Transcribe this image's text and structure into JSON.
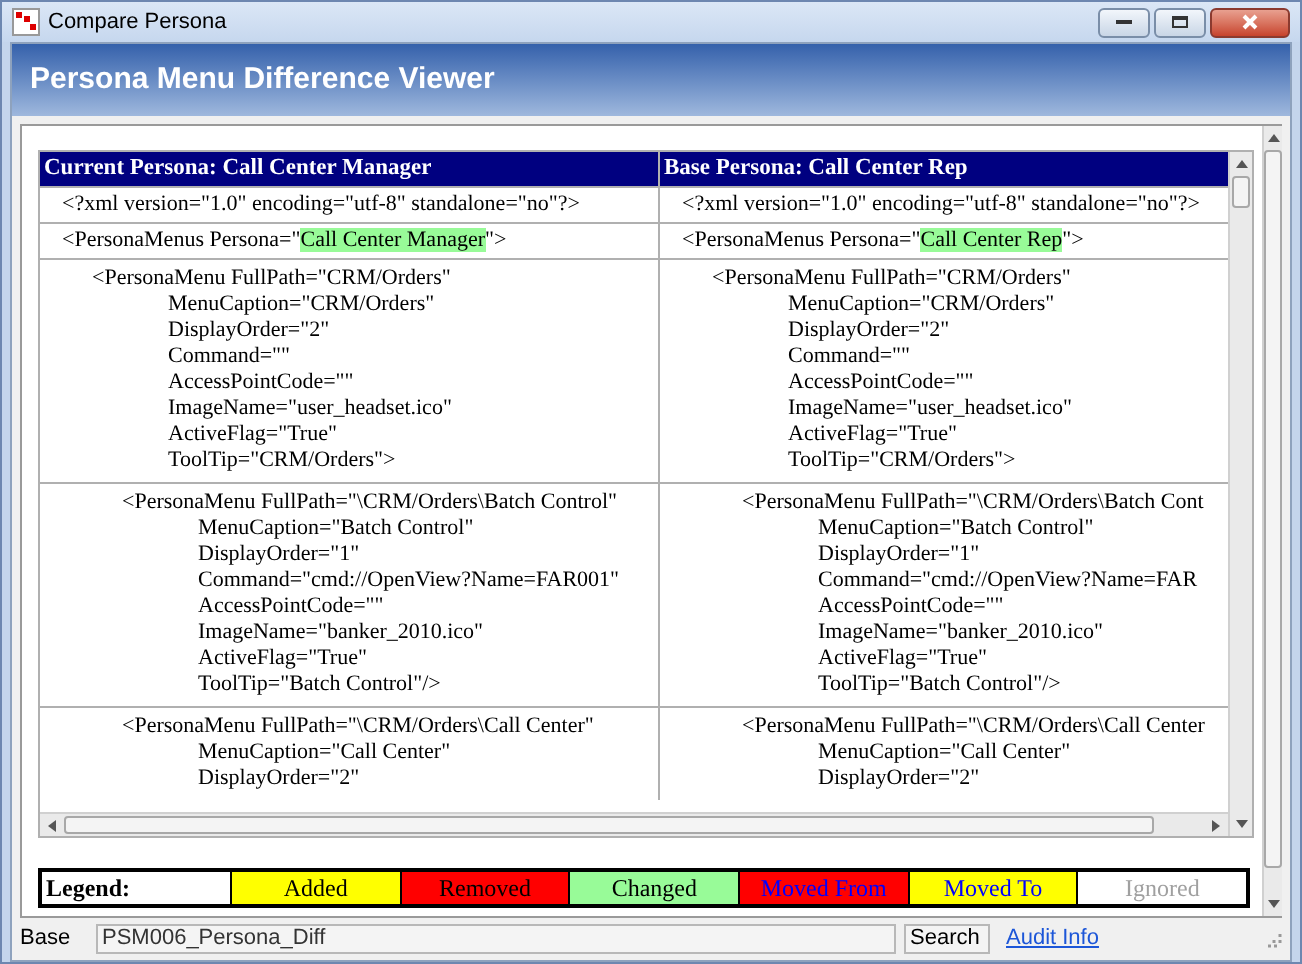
{
  "window": {
    "title": "Compare Persona"
  },
  "header": {
    "title": "Persona Menu Difference Viewer"
  },
  "table": {
    "columns": [
      "Current Persona: Call Center Manager",
      "Base Persona: Call Center Rep"
    ],
    "rows": [
      {
        "kind": "declaration",
        "cells": [
          {
            "tag": [
              {
                "text": "<?xml version=\"1.0\" encoding=\"utf-8\" standalone=\"no\"?>",
                "changed": false
              }
            ]
          },
          {
            "tag": [
              {
                "text": "<?xml version=\"1.0\" encoding=\"utf-8\" standalone=\"no\"?>",
                "changed": false
              }
            ]
          }
        ]
      },
      {
        "kind": "declaration",
        "cells": [
          {
            "tag": [
              {
                "text": "<PersonaMenus Persona=\"",
                "changed": false
              },
              {
                "text": "Call Center Manager",
                "changed": true
              },
              {
                "text": "\">",
                "changed": false
              }
            ]
          },
          {
            "tag": [
              {
                "text": "<PersonaMenus Persona=\"",
                "changed": false
              },
              {
                "text": "Call Center Rep",
                "changed": true
              },
              {
                "text": "\">",
                "changed": false
              }
            ]
          }
        ]
      },
      {
        "kind": "menu",
        "cells": [
          {
            "tag": [
              {
                "text": "<PersonaMenu FullPath=\"CRM/Orders\"",
                "changed": false
              }
            ],
            "attributes": [
              "MenuCaption=\"CRM/Orders\"",
              "DisplayOrder=\"2\"",
              "Command=\"\"",
              "AccessPointCode=\"\"",
              "ImageName=\"user_headset.ico\"",
              "ActiveFlag=\"True\"",
              "ToolTip=\"CRM/Orders\">"
            ]
          },
          {
            "tag": [
              {
                "text": "<PersonaMenu FullPath=\"CRM/Orders\"",
                "changed": false
              }
            ],
            "attributes": [
              "MenuCaption=\"CRM/Orders\"",
              "DisplayOrder=\"2\"",
              "Command=\"\"",
              "AccessPointCode=\"\"",
              "ImageName=\"user_headset.ico\"",
              "ActiveFlag=\"True\"",
              "ToolTip=\"CRM/Orders\">"
            ]
          }
        ]
      },
      {
        "kind": "submenu",
        "cells": [
          {
            "tag": [
              {
                "text": "<PersonaMenu FullPath=\"\\CRM/Orders\\Batch Control\"",
                "changed": false
              }
            ],
            "attributes": [
              "MenuCaption=\"Batch Control\"",
              "DisplayOrder=\"1\"",
              "Command=\"cmd://OpenView?Name=FAR001\"",
              "AccessPointCode=\"\"",
              "ImageName=\"banker_2010.ico\"",
              "ActiveFlag=\"True\"",
              "ToolTip=\"Batch Control\"/>"
            ]
          },
          {
            "tag": [
              {
                "text": "<PersonaMenu FullPath=\"\\CRM/Orders\\Batch Cont",
                "changed": false
              }
            ],
            "attributes": [
              "MenuCaption=\"Batch Control\"",
              "DisplayOrder=\"1\"",
              "Command=\"cmd://OpenView?Name=FAR",
              "AccessPointCode=\"\"",
              "ImageName=\"banker_2010.ico\"",
              "ActiveFlag=\"True\"",
              "ToolTip=\"Batch Control\"/>"
            ]
          }
        ]
      },
      {
        "kind": "submenu",
        "cells": [
          {
            "tag": [
              {
                "text": "<PersonaMenu FullPath=\"\\CRM/Orders\\Call Center\"",
                "changed": false
              }
            ],
            "attributes": [
              "MenuCaption=\"Call Center\"",
              "DisplayOrder=\"2\""
            ]
          },
          {
            "tag": [
              {
                "text": "<PersonaMenu FullPath=\"\\CRM/Orders\\Call Center",
                "changed": false
              }
            ],
            "attributes": [
              "MenuCaption=\"Call Center\"",
              "DisplayOrder=\"2\""
            ]
          }
        ]
      }
    ]
  },
  "legend": {
    "label": "Legend:",
    "items": [
      {
        "label": "Added",
        "color": "#ffff00",
        "kind": "change"
      },
      {
        "label": "Removed",
        "color": "#ff0000",
        "kind": "change"
      },
      {
        "label": "Changed",
        "color": "#98fb98",
        "kind": "change"
      },
      {
        "label": "Moved From",
        "color": "#ff0000",
        "kind": "move"
      },
      {
        "label": "Moved To",
        "color": "#ffff00",
        "kind": "move"
      },
      {
        "label": "Ignored",
        "color": "#ffffff",
        "kind": "ignored"
      }
    ]
  },
  "status_bar": {
    "label": "Base",
    "value": "PSM006_Persona_Diff",
    "search": "Search",
    "link": "Audit Info"
  }
}
